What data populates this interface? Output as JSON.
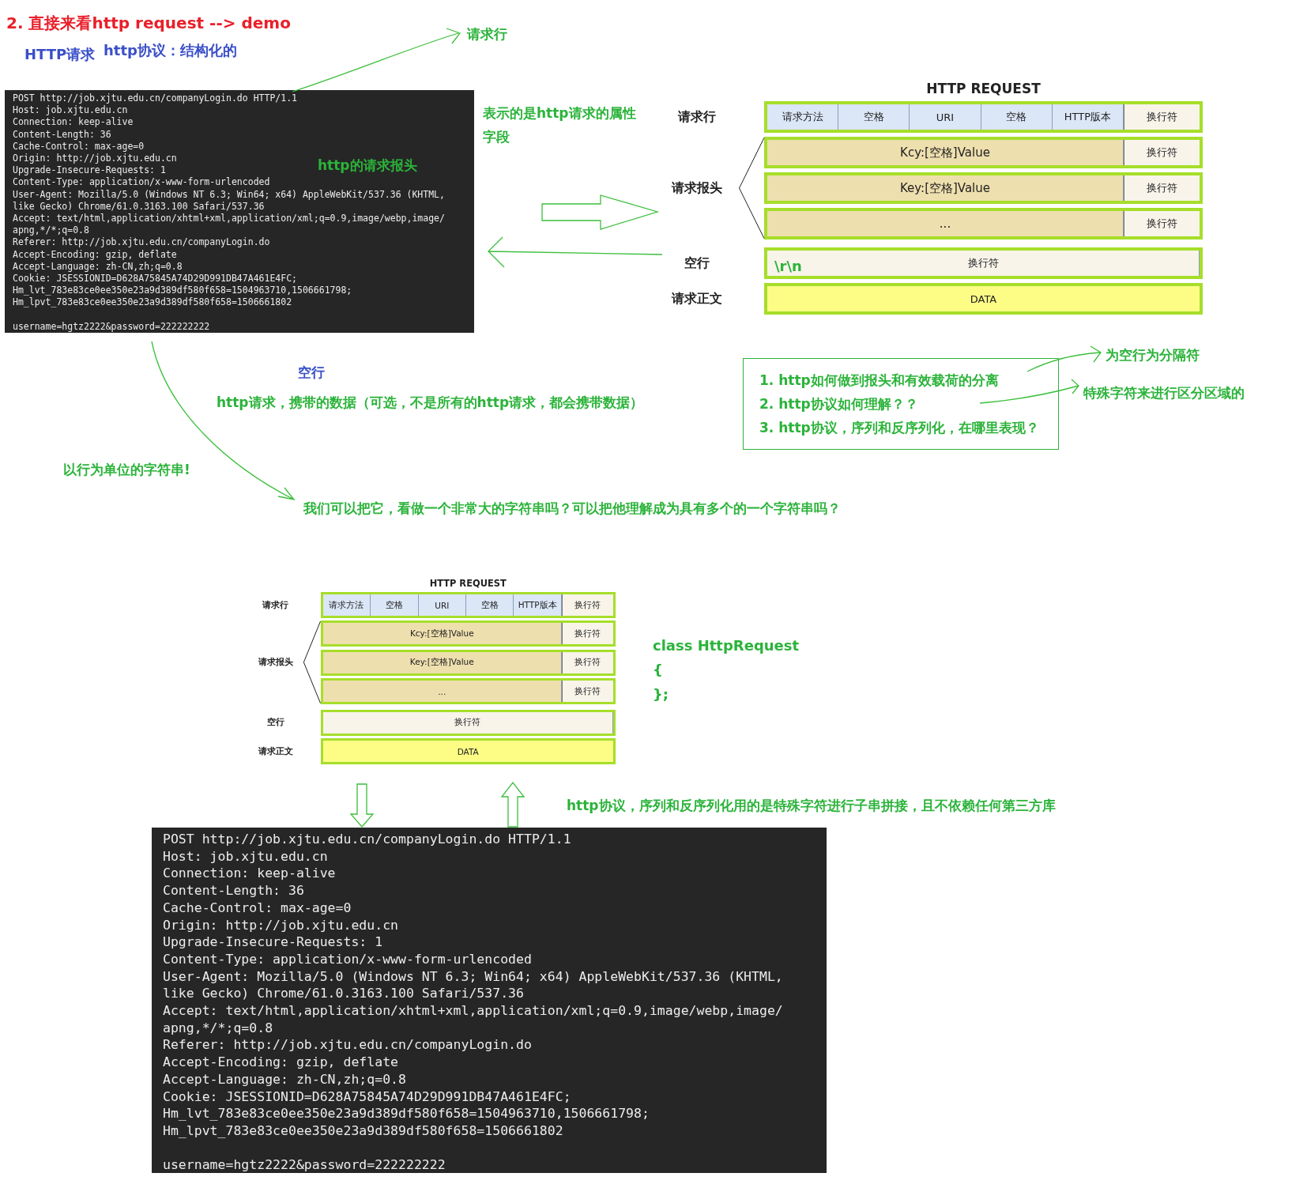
{
  "heading": "2. 直接来看http request --> demo",
  "subtitles": [
    "HTTP请求",
    "http协议：结构化的"
  ],
  "annotations": [
    {
      "text": "请求行",
      "color": "#2bb33a"
    },
    {
      "text": "表示的是http请求的属性字段",
      "color": "#2bb33a"
    },
    {
      "text": "http的请求报头",
      "color": "#2bb33a"
    },
    {
      "text": "空行",
      "color": "#3a4fc8"
    },
    {
      "text": "http请求，携带的数据（可选，不是所有的http请求，都会携带数据）",
      "color": "#2bb33a"
    },
    {
      "text": "以行为单位的字符串!",
      "color": "#2bb33a"
    },
    {
      "text": "我们可以把它，看做一个非常大的字符串吗？可以把他理解成为具有多个的一个字符串吗？",
      "color": "#2bb33a"
    },
    {
      "text": "为空行为分隔符",
      "color": "#2bb33a"
    },
    {
      "text": "特殊字符来进行区分区域的",
      "color": "#2bb33a"
    },
    {
      "text": "http协议，序列和反序列化用的是特殊字符进行子串拼接，且不依赖任何第三方库",
      "color": "#2bb33a"
    }
  ],
  "questions": [
    "1. http如何做到报头和有效载荷的分离",
    "2. http协议如何理解？？",
    "3. http协议，序列和反序列化，在哪里表现？"
  ],
  "code": [
    "class HttpRequest",
    "{",
    "};"
  ],
  "diagrams": [
    {
      "title": "HTTP REQUEST",
      "request_line": {
        "label": "请求行",
        "cells": [
          "请求方法",
          "空格",
          "URI",
          "空格",
          "HTTP版本"
        ],
        "end": "换行符"
      },
      "headers": {
        "label": "请求报头",
        "rows": [
          {
            "text": "Kcy:[空格]Value",
            "end": "换行符"
          },
          {
            "text": "Key:[空格]Value",
            "end": "换行符"
          },
          {
            "text": "...",
            "end": "换行符"
          }
        ]
      },
      "blank_line": {
        "label": "空行",
        "mark": "\\r\\n",
        "text": "换行符"
      },
      "body": {
        "label": "请求正文",
        "text": "DATA"
      }
    },
    {
      "title": "HTTP REQUEST",
      "request_line": {
        "label": "请求行",
        "cells": [
          "请求方法",
          "空格",
          "URI",
          "空格",
          "HTTP版本"
        ],
        "end": "换行符"
      },
      "headers": {
        "label": "请求报头",
        "rows": [
          {
            "text": "Kcy:[空格]Value",
            "end": "换行符"
          },
          {
            "text": "Key:[空格]Value",
            "end": "换行符"
          },
          {
            "text": "...",
            "end": "换行符"
          }
        ]
      },
      "blank_line": {
        "label": "空行",
        "text": "换行符"
      },
      "body": {
        "label": "请求正文",
        "text": "DATA"
      }
    }
  ],
  "terminals": [
    {
      "header_lines": [
        "POST http://job.xjtu.edu.cn/companyLogin.do HTTP/1.1",
        "Host: job.xjtu.edu.cn",
        "Connection: keep-alive",
        "Content-Length: 36",
        "Cache-Control: max-age=0",
        "Origin: http://job.xjtu.edu.cn",
        "Upgrade-Insecure-Requests: 1",
        "Content-Type: application/x-www-form-urlencoded",
        "User-Agent: Mozilla/5.0 (Windows NT 6.3; Win64; x64) AppleWebKit/537.36 (KHTML,",
        "like Gecko) Chrome/61.0.3163.100 Safari/537.36",
        "Accept: text/html,application/xhtml+xml,application/xml;q=0.9,image/webp,image/",
        "apng,*/*;q=0.8",
        "Referer: http://job.xjtu.edu.cn/companyLogin.do",
        "Accept-Encoding: gzip, deflate",
        "Accept-Language: zh-CN,zh;q=0.8",
        "Cookie: JSESSIONID=D628A75845A74D29D991DB47A461E4FC;",
        "Hm_lvt_783e83ce0ee350e23a9d389df580f658=1504963710,1506661798;",
        "Hm_lpvt_783e83ce0ee350e23a9d389df580f658=1506661802"
      ],
      "body": "username=hgtz2222&password=222222222"
    },
    {
      "header_lines": [
        "POST http://job.xjtu.edu.cn/companyLogin.do HTTP/1.1",
        "Host: job.xjtu.edu.cn",
        "Connection: keep-alive",
        "Content-Length: 36",
        "Cache-Control: max-age=0",
        "Origin: http://job.xjtu.edu.cn",
        "Upgrade-Insecure-Requests: 1",
        "Content-Type: application/x-www-form-urlencoded",
        "User-Agent: Mozilla/5.0 (Windows NT 6.3; Win64; x64) AppleWebKit/537.36 (KHTML,",
        "like Gecko) Chrome/61.0.3163.100 Safari/537.36",
        "Accept: text/html,application/xhtml+xml,application/xml;q=0.9,image/webp,image/",
        "apng,*/*;q=0.8",
        "Referer: http://job.xjtu.edu.cn/companyLogin.do",
        "Accept-Encoding: gzip, deflate",
        "Accept-Language: zh-CN,zh;q=0.8",
        "Cookie: JSESSIONID=D628A75845A74D29D991DB47A461E4FC;",
        "Hm_lvt_783e83ce0ee350e23a9d389df580f658=1504963710,1506661798;",
        "Hm_lpvt_783e83ce0ee350e23a9d389df580f658=1506661802"
      ],
      "body": "username=hgtz2222&password=222222222"
    }
  ]
}
